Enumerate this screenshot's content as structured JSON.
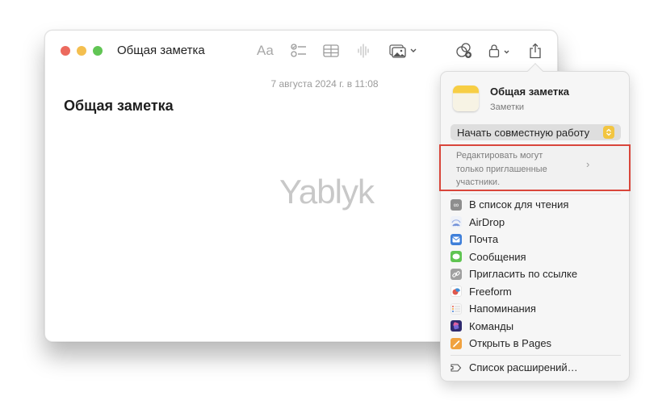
{
  "window": {
    "title": "Общая заметка",
    "toolbar": {
      "format_label": "Aa",
      "icons": [
        "format-text-icon",
        "checklist-icon",
        "table-icon",
        "audio-waveform-icon",
        "media-icon",
        "collaborate-icon",
        "lock-icon",
        "share-icon"
      ]
    }
  },
  "note": {
    "date": "7 августа 2024 г. в 11:08",
    "title": "Общая заметка",
    "watermark": "Yablyk"
  },
  "share_popover": {
    "app_name": "Общая заметка",
    "app_subtitle": "Заметки",
    "collab_select": {
      "selected": "Начать совместную работу"
    },
    "permission": {
      "text": "Редактировать могут только приглашенные участники.",
      "highlight_color": "#d9463b"
    },
    "items": [
      {
        "label": "В список для чтения",
        "icon": "reading-list-icon",
        "color": "#8e8e8e"
      },
      {
        "label": "AirDrop",
        "icon": "airdrop-icon",
        "color": "#6f8fd8"
      },
      {
        "label": "Почта",
        "icon": "mail-icon",
        "color": "#3f7fd9"
      },
      {
        "label": "Сообщения",
        "icon": "messages-icon",
        "color": "#5fc451"
      },
      {
        "label": "Пригласить по ссылке",
        "icon": "link-icon",
        "color": "#9a9a9a"
      },
      {
        "label": "Freeform",
        "icon": "freeform-icon",
        "color": "#3f8fd6"
      },
      {
        "label": "Напоминания",
        "icon": "reminders-icon",
        "color": "#f2f2f2"
      },
      {
        "label": "Команды",
        "icon": "shortcuts-icon",
        "color": "#3b2f8a"
      },
      {
        "label": "Открыть в Pages",
        "icon": "pages-icon",
        "color": "#f0a240"
      }
    ],
    "extensions_label": "Список расширений…"
  }
}
